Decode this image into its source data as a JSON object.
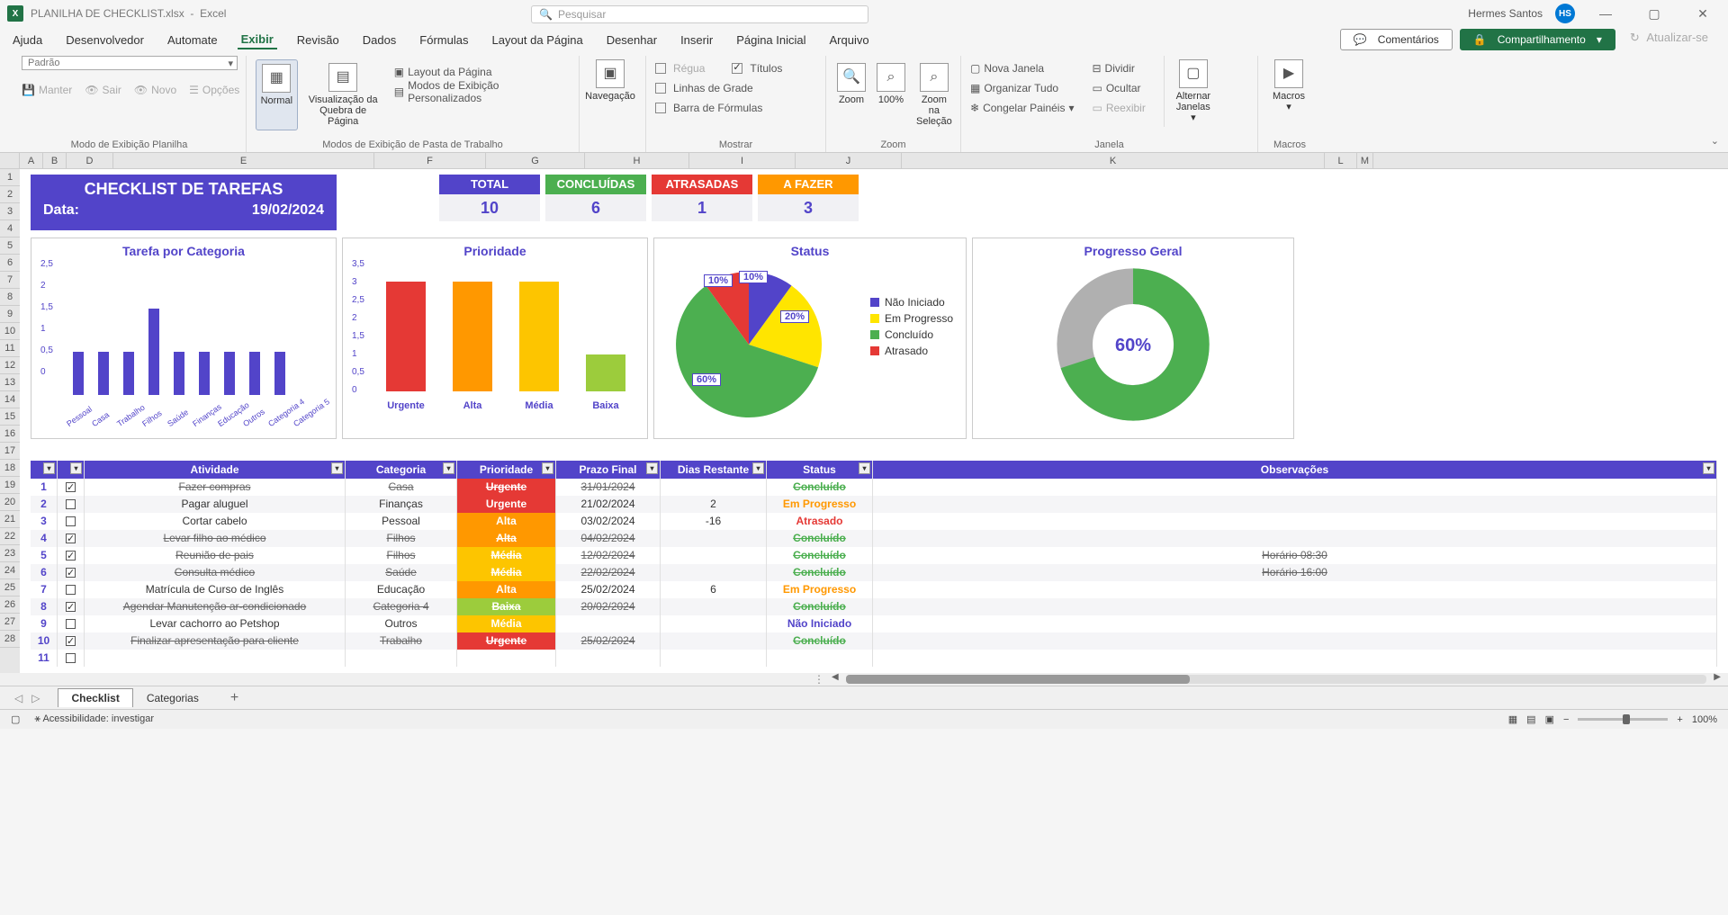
{
  "titlebar": {
    "filename": "PLANILHA DE CHECKLIST.xlsx",
    "app": "Excel",
    "search_placeholder": "Pesquisar",
    "user": "Hermes Santos",
    "initials": "HS"
  },
  "menu": {
    "items": [
      "Arquivo",
      "Página Inicial",
      "Inserir",
      "Desenhar",
      "Layout da Página",
      "Fórmulas",
      "Dados",
      "Revisão",
      "Exibir",
      "Automate",
      "Desenvolvedor",
      "Ajuda"
    ],
    "active": "Exibir",
    "comments": "Comentários",
    "share": "Compartilhamento",
    "refresh": "Atualizar-se"
  },
  "ribbon": {
    "g1": {
      "label": "Modo de Exibição Planilha",
      "default": "Padrão",
      "keep": "Manter",
      "exit": "Sair",
      "new": "Novo",
      "options": "Opções"
    },
    "g2": {
      "label": "Modos de Exibição de Pasta de Trabalho",
      "normal": "Normal",
      "pagebreak": "Visualização da Quebra de Página",
      "pagelayout": "Layout da Página",
      "custom": "Modos de Exibição Personalizados"
    },
    "g3": {
      "nav": "Navegação"
    },
    "g4": {
      "label": "Mostrar",
      "ruler": "Régua",
      "gridlines": "Linhas de Grade",
      "formula": "Barra de Fórmulas",
      "headings": "Títulos"
    },
    "g5": {
      "label": "Zoom",
      "zoom": "Zoom",
      "z100": "100%",
      "zsel": "Zoom na Seleção"
    },
    "g6": {
      "label": "Janela",
      "newwin": "Nova Janela",
      "arrange": "Organizar Tudo",
      "freeze": "Congelar Painéis",
      "split": "Dividir",
      "hide": "Ocultar",
      "unhide": "Reexibir",
      "switch": "Alternar Janelas"
    },
    "g7": {
      "label": "Macros",
      "macros": "Macros"
    }
  },
  "columns": [
    "A",
    "B",
    "D",
    "E",
    "F",
    "G",
    "H",
    "I",
    "J",
    "K",
    "L",
    "M"
  ],
  "dashboard": {
    "title": "CHECKLIST DE TAREFAS",
    "date_label": "Data:",
    "date": "19/02/2024",
    "stats": [
      {
        "label": "TOTAL",
        "value": "10",
        "color": "#5244c9"
      },
      {
        "label": "CONCLUÍDAS",
        "value": "6",
        "color": "#4caf50"
      },
      {
        "label": "ATRASADAS",
        "value": "1",
        "color": "#e53935"
      },
      {
        "label": "A FAZER",
        "value": "3",
        "color": "#ff9800"
      }
    ]
  },
  "chart_data": [
    {
      "type": "bar",
      "title": "Tarefa por Categoria",
      "ylim": [
        0,
        2.5
      ],
      "yticks": [
        "2,5",
        "2",
        "1,5",
        "1",
        "0,5",
        "0"
      ],
      "categories": [
        "Pessoal",
        "Casa",
        "Trabalho",
        "Filhos",
        "Saúde",
        "Finanças",
        "Educação",
        "Outros",
        "Categoria 4",
        "Categoria 5"
      ],
      "values": [
        1,
        1,
        1,
        2,
        1,
        1,
        1,
        1,
        1,
        0
      ],
      "color": "#5244c9"
    },
    {
      "type": "bar",
      "title": "Prioridade",
      "ylim": [
        0,
        3.5
      ],
      "yticks": [
        "3,5",
        "3",
        "2,5",
        "2",
        "1,5",
        "1",
        "0,5",
        "0"
      ],
      "categories": [
        "Urgente",
        "Alta",
        "Média",
        "Baixa"
      ],
      "values": [
        3,
        3,
        3,
        1
      ],
      "colors": [
        "#e53935",
        "#ff9800",
        "#fdc500",
        "#9ccc3c"
      ]
    },
    {
      "type": "pie",
      "title": "Status",
      "series": [
        {
          "name": "Não Iniciado",
          "value": 10,
          "color": "#5244c9"
        },
        {
          "name": "Em Progresso",
          "value": 20,
          "color": "#ffe500"
        },
        {
          "name": "Concluído",
          "value": 60,
          "color": "#4caf50"
        },
        {
          "name": "Atrasado",
          "value": 10,
          "color": "#e53935"
        }
      ]
    },
    {
      "type": "pie",
      "title": "Progresso Geral",
      "donut": true,
      "center_label": "60%",
      "series": [
        {
          "name": "done",
          "value": 60,
          "color": "#4caf50"
        },
        {
          "name": "remain",
          "value": 40,
          "color": "#b0b0b0"
        }
      ]
    }
  ],
  "table": {
    "headers": [
      "",
      "",
      "Atividade",
      "Categoria",
      "Prioridade",
      "Prazo Final",
      "Dias Restante",
      "Status",
      "Observações"
    ],
    "rows": [
      {
        "n": "1",
        "chk": true,
        "act": "Fazer compras",
        "cat": "Casa",
        "pri": "Urgente",
        "pri_bg": "#e53935",
        "date": "31/01/2024",
        "days": "",
        "stat": "Concluído",
        "stat_cls": "conc",
        "obs": "",
        "strike": true
      },
      {
        "n": "2",
        "chk": false,
        "act": "Pagar aluguel",
        "cat": "Finanças",
        "pri": "Urgente",
        "pri_bg": "#e53935",
        "date": "21/02/2024",
        "days": "2",
        "stat": "Em Progresso",
        "stat_cls": "prog",
        "obs": "",
        "strike": false
      },
      {
        "n": "3",
        "chk": false,
        "act": "Cortar cabelo",
        "cat": "Pessoal",
        "pri": "Alta",
        "pri_bg": "#ff9800",
        "date": "03/02/2024",
        "days": "-16",
        "stat": "Atrasado",
        "stat_cls": "atr",
        "obs": "",
        "strike": false
      },
      {
        "n": "4",
        "chk": true,
        "act": "Levar filho ao médico",
        "cat": "Filhos",
        "pri": "Alta",
        "pri_bg": "#ff9800",
        "date": "04/02/2024",
        "days": "",
        "stat": "Concluído",
        "stat_cls": "conc",
        "obs": "",
        "strike": true
      },
      {
        "n": "5",
        "chk": true,
        "act": "Reunião de pais",
        "cat": "Filhos",
        "pri": "Média",
        "pri_bg": "#fdc500",
        "date": "12/02/2024",
        "days": "",
        "stat": "Concluído",
        "stat_cls": "conc",
        "obs": "Horário 08:30",
        "strike": true
      },
      {
        "n": "6",
        "chk": true,
        "act": "Consulta médico",
        "cat": "Saúde",
        "pri": "Média",
        "pri_bg": "#fdc500",
        "date": "22/02/2024",
        "days": "",
        "stat": "Concluído",
        "stat_cls": "conc",
        "obs": "Horário 16:00",
        "strike": true
      },
      {
        "n": "7",
        "chk": false,
        "act": "Matrícula de Curso de Inglês",
        "cat": "Educação",
        "pri": "Alta",
        "pri_bg": "#ff9800",
        "date": "25/02/2024",
        "days": "6",
        "stat": "Em Progresso",
        "stat_cls": "prog",
        "obs": "",
        "strike": false
      },
      {
        "n": "8",
        "chk": true,
        "act": "Agendar Manutenção ar-condicionado",
        "cat": "Categoria 4",
        "pri": "Baixa",
        "pri_bg": "#9ccc3c",
        "date": "20/02/2024",
        "days": "",
        "stat": "Concluído",
        "stat_cls": "conc",
        "obs": "",
        "strike": true
      },
      {
        "n": "9",
        "chk": false,
        "act": "Levar cachorro ao Petshop",
        "cat": "Outros",
        "pri": "Média",
        "pri_bg": "#fdc500",
        "date": "",
        "days": "",
        "stat": "Não Iniciado",
        "stat_cls": "nini",
        "obs": "",
        "strike": false
      },
      {
        "n": "10",
        "chk": true,
        "act": "Finalizar apresentação para cliente",
        "cat": "Trabalho",
        "pri": "Urgente",
        "pri_bg": "#e53935",
        "date": "25/02/2024",
        "days": "",
        "stat": "Concluído",
        "stat_cls": "conc",
        "obs": "",
        "strike": true
      },
      {
        "n": "11",
        "chk": false,
        "act": "",
        "cat": "",
        "pri": "",
        "pri_bg": "",
        "date": "",
        "days": "",
        "stat": "",
        "stat_cls": "",
        "obs": "",
        "strike": false
      }
    ]
  },
  "tabs": {
    "items": [
      "Checklist",
      "Categorias"
    ],
    "active": "Checklist"
  },
  "statusbar": {
    "accessibility": "Acessibilidade: investigar",
    "zoom": "100%"
  }
}
